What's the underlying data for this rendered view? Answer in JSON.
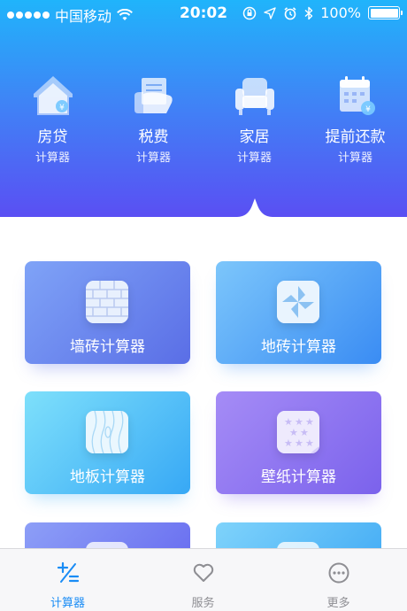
{
  "status_bar": {
    "carrier": "中国移动",
    "time": "20:02",
    "battery": "100%"
  },
  "categories": [
    {
      "title": "房贷",
      "subtitle": "计算器",
      "icon": "house-icon"
    },
    {
      "title": "税费",
      "subtitle": "计算器",
      "icon": "tax-icon"
    },
    {
      "title": "家居",
      "subtitle": "计算器",
      "icon": "sofa-icon"
    },
    {
      "title": "提前还款",
      "subtitle": "计算器",
      "icon": "calendar-icon"
    }
  ],
  "selected_category": "家居",
  "cards": [
    {
      "label": "墙砖计算器",
      "icon": "wall-brick-icon"
    },
    {
      "label": "地砖计算器",
      "icon": "floor-tile-icon"
    },
    {
      "label": "地板计算器",
      "icon": "wood-floor-icon"
    },
    {
      "label": "壁纸计算器",
      "icon": "wallpaper-icon"
    }
  ],
  "tabbar": {
    "items": [
      {
        "label": "计算器",
        "icon": "plus-minus-icon",
        "active": true
      },
      {
        "label": "服务",
        "icon": "heart-icon",
        "active": false
      },
      {
        "label": "更多",
        "icon": "more-icon",
        "active": false
      }
    ],
    "active_color": "#1a8cf5",
    "inactive_color": "#8e8e93"
  },
  "colors": {
    "header_top": "#20b4fb",
    "header_bottom": "#5a4ff3"
  }
}
